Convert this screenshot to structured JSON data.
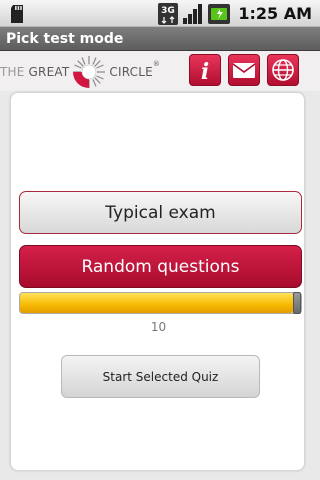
{
  "status_bar": {
    "time": "1:25 AM",
    "icons": [
      "sd-card-icon",
      "3g-icon",
      "signal-icon",
      "battery-icon"
    ]
  },
  "title_bar": {
    "title": "Pick test mode"
  },
  "header": {
    "logo_part1": "THE",
    "logo_part2": "GREAT",
    "logo_part3": "CIRCLE",
    "logo_mark": "®",
    "buttons": [
      "info-icon",
      "mail-icon",
      "globe-icon"
    ],
    "info_letter": "i"
  },
  "quiz": {
    "typical_label": "Typical exam",
    "random_label": "Random questions",
    "slider_value": "10",
    "slider_fraction": 0.97,
    "start_label": "Start Selected Quiz"
  },
  "colors": {
    "accent_red": "#c0143a",
    "slider_yellow": "#f6b900"
  }
}
